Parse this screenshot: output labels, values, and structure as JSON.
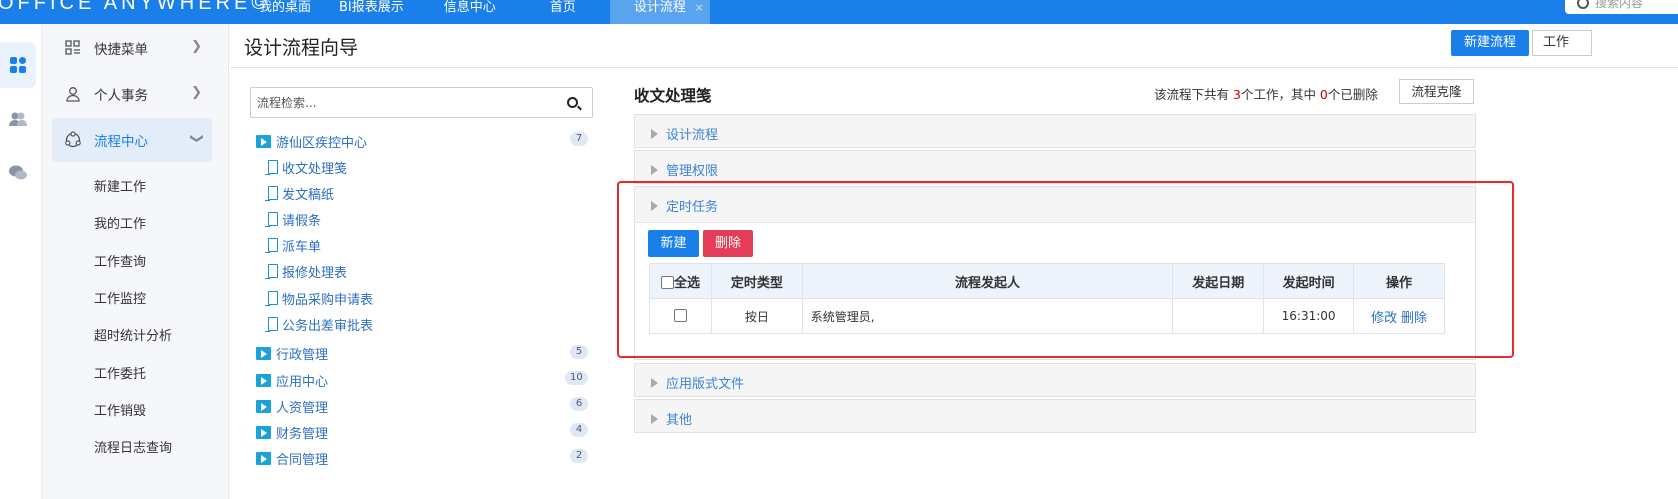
{
  "brand": {
    "logo_text": "OFFICE ANYWHERE©"
  },
  "topnav": [
    {
      "label": "我的桌面"
    },
    {
      "label": "BI报表展示"
    },
    {
      "label": "信息中心"
    },
    {
      "label": "首页"
    },
    {
      "label": "设计流程",
      "active": true,
      "close": "×"
    }
  ],
  "top_search": {
    "placeholder": "搜索内容"
  },
  "rail_icons": [
    "apps-icon",
    "users-icon",
    "chat-icon"
  ],
  "menu": {
    "items": [
      {
        "label": "快捷菜单",
        "icon": "shortcut-icon"
      },
      {
        "label": "个人事务",
        "icon": "person-icon"
      },
      {
        "label": "流程中心",
        "icon": "flow-icon",
        "active": true
      }
    ],
    "sub_items": [
      "新建工作",
      "我的工作",
      "工作查询",
      "工作监控",
      "超时统计分析",
      "工作委托",
      "工作销毁",
      "流程日志查询"
    ]
  },
  "page": {
    "title": "设计流程向导",
    "new_flow_button": "新建流程",
    "work_button": "工作"
  },
  "tree": {
    "search_placeholder": "流程检索...",
    "root": {
      "label": "游仙区疾控中心",
      "count": "7"
    },
    "children": [
      "收文处理笺",
      "发文稿纸",
      "请假条",
      "派车单",
      "报修处理表",
      "物品采购申请表",
      "公务出差审批表"
    ],
    "folders": [
      {
        "label": "行政管理",
        "count": "5"
      },
      {
        "label": "应用中心",
        "count": "10"
      },
      {
        "label": "人资管理",
        "count": "6"
      },
      {
        "label": "财务管理",
        "count": "4"
      },
      {
        "label": "合同管理",
        "count": "2"
      }
    ]
  },
  "detail": {
    "title": "收文处理笺",
    "info_prefix": "该流程下共有 ",
    "work_count": "3",
    "info_mid": "个工作，其中 ",
    "deleted_count": "0",
    "info_suffix": "个已删除",
    "clone_button": "流程克隆",
    "panels": [
      "设计流程",
      "管理权限",
      "定时任务",
      "应用版式文件",
      "其他"
    ],
    "task_buttons": {
      "new": "新建",
      "delete": "删除"
    },
    "table": {
      "headers": [
        "全选",
        "定时类型",
        "流程发起人",
        "发起日期",
        "发起时间",
        "操作"
      ],
      "rows": [
        {
          "type": "按日",
          "initiator": "系统管理员,",
          "date": "",
          "time": "16:31:00",
          "edit": "修改",
          "delete": "删除"
        }
      ]
    }
  },
  "colors": {
    "primary": "#1a7fe8",
    "danger": "#e33d59",
    "highlight_box": "#e8282d",
    "link": "#2b6fc2"
  }
}
